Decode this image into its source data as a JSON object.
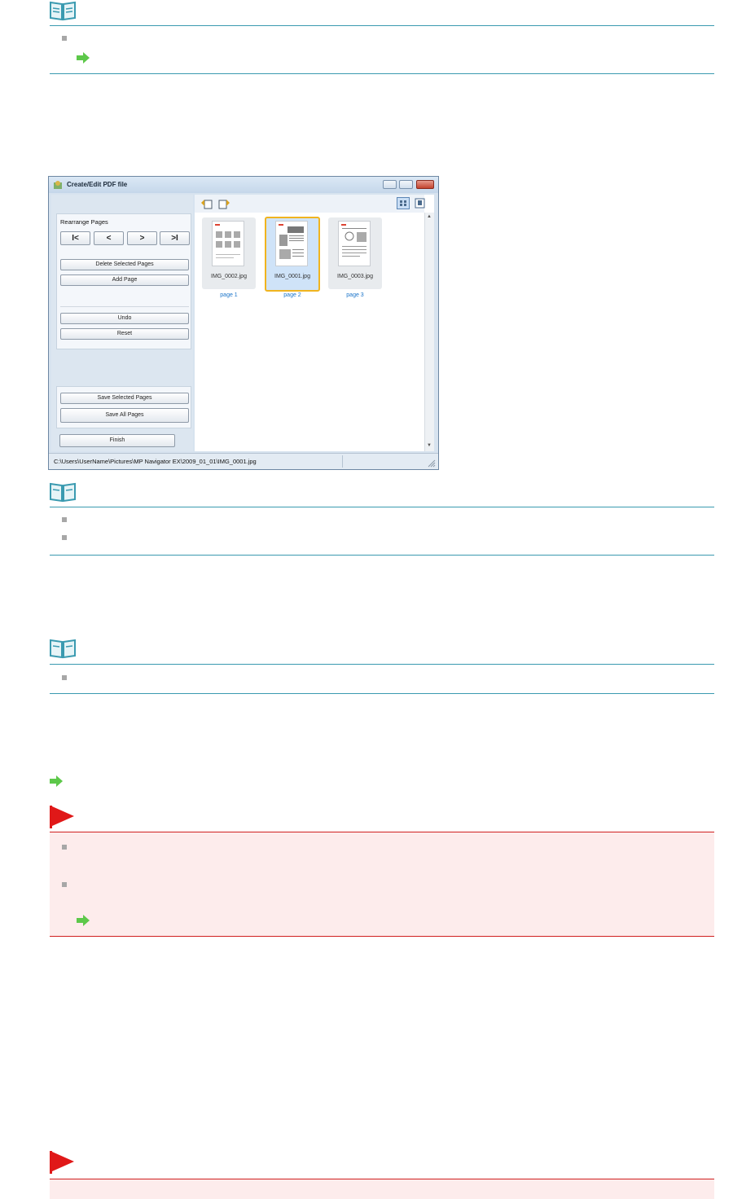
{
  "window": {
    "title": "Create/Edit PDF file",
    "rearrange_label": "Rearrange Pages",
    "nav_buttons": [
      "I<",
      "<",
      ">",
      ">I"
    ],
    "delete_label": "Delete Selected Pages",
    "add_label": "Add Page",
    "undo_label": "Undo",
    "reset_label": "Reset",
    "save_selected_label": "Save Selected Pages",
    "save_all_label": "Save All Pages",
    "finish_label": "Finish",
    "thumbnails": [
      {
        "name": "IMG_0002.jpg",
        "page": "page 1",
        "selected": false
      },
      {
        "name": "IMG_0001.jpg",
        "page": "page 2",
        "selected": true
      },
      {
        "name": "IMG_0003.jpg",
        "page": "page 3",
        "selected": false
      }
    ],
    "status_path": "C:\\Users\\UserName\\Pictures\\MP Navigator EX\\2009_01_01\\IMG_0001.jpg"
  },
  "colors": {
    "note_rule": "#3a9ab0",
    "important_rule": "#d01f1f",
    "important_bg": "#fdecec",
    "link_arrow": "#5dc84a",
    "page_label": "#1a74c9",
    "selection": "#f0b41f"
  }
}
